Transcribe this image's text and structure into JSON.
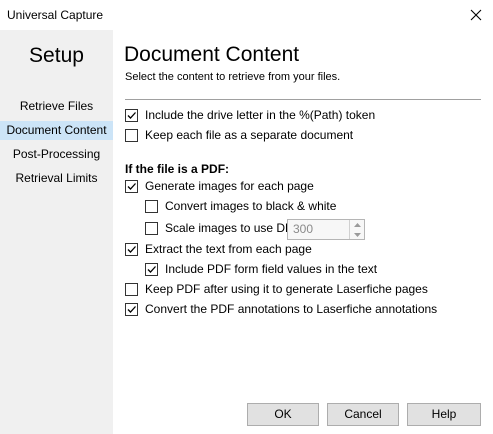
{
  "window": {
    "title": "Universal Capture"
  },
  "sidebar": {
    "heading": "Setup",
    "items": [
      {
        "label": "Retrieve Files",
        "active": false
      },
      {
        "label": "Document Content",
        "active": true
      },
      {
        "label": "Post-Processing",
        "active": false
      },
      {
        "label": "Retrieval Limits",
        "active": false
      }
    ]
  },
  "main": {
    "title": "Document Content",
    "subtitle": "Select the content to retrieve from your files.",
    "options": {
      "drive_letter": {
        "label": "Include the drive letter in the %(Path) token",
        "checked": true
      },
      "separate_doc": {
        "label": "Keep each file as a separate document",
        "checked": false
      }
    },
    "pdf_section": {
      "label": "If the file is a PDF:",
      "generate_images": {
        "label": "Generate images for each page",
        "checked": true
      },
      "black_white": {
        "label": "Convert images to black & white",
        "checked": false
      },
      "scale_dpi": {
        "label": "Scale images to use DPI:",
        "checked": false,
        "value": "300"
      },
      "extract_text": {
        "label": "Extract the text from each page",
        "checked": true
      },
      "form_fields": {
        "label": "Include PDF form field values in the text",
        "checked": true
      },
      "keep_pdf": {
        "label": "Keep PDF after using it to generate Laserfiche pages",
        "checked": false
      },
      "annotations": {
        "label": "Convert the PDF annotations to Laserfiche annotations",
        "checked": true
      }
    }
  },
  "buttons": {
    "ok": "OK",
    "cancel": "Cancel",
    "help": "Help"
  }
}
